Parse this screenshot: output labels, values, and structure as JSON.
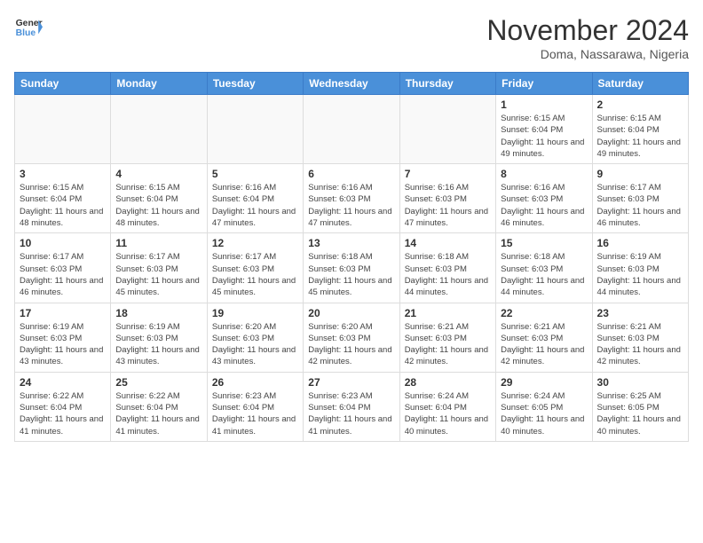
{
  "logo": {
    "line1": "General",
    "line2": "Blue"
  },
  "calendar": {
    "title": "November 2024",
    "subtitle": "Doma, Nassarawa, Nigeria",
    "headers": [
      "Sunday",
      "Monday",
      "Tuesday",
      "Wednesday",
      "Thursday",
      "Friday",
      "Saturday"
    ],
    "weeks": [
      [
        {
          "day": "",
          "info": ""
        },
        {
          "day": "",
          "info": ""
        },
        {
          "day": "",
          "info": ""
        },
        {
          "day": "",
          "info": ""
        },
        {
          "day": "",
          "info": ""
        },
        {
          "day": "1",
          "info": "Sunrise: 6:15 AM\nSunset: 6:04 PM\nDaylight: 11 hours and 49 minutes."
        },
        {
          "day": "2",
          "info": "Sunrise: 6:15 AM\nSunset: 6:04 PM\nDaylight: 11 hours and 49 minutes."
        }
      ],
      [
        {
          "day": "3",
          "info": "Sunrise: 6:15 AM\nSunset: 6:04 PM\nDaylight: 11 hours and 48 minutes."
        },
        {
          "day": "4",
          "info": "Sunrise: 6:15 AM\nSunset: 6:04 PM\nDaylight: 11 hours and 48 minutes."
        },
        {
          "day": "5",
          "info": "Sunrise: 6:16 AM\nSunset: 6:04 PM\nDaylight: 11 hours and 47 minutes."
        },
        {
          "day": "6",
          "info": "Sunrise: 6:16 AM\nSunset: 6:03 PM\nDaylight: 11 hours and 47 minutes."
        },
        {
          "day": "7",
          "info": "Sunrise: 6:16 AM\nSunset: 6:03 PM\nDaylight: 11 hours and 47 minutes."
        },
        {
          "day": "8",
          "info": "Sunrise: 6:16 AM\nSunset: 6:03 PM\nDaylight: 11 hours and 46 minutes."
        },
        {
          "day": "9",
          "info": "Sunrise: 6:17 AM\nSunset: 6:03 PM\nDaylight: 11 hours and 46 minutes."
        }
      ],
      [
        {
          "day": "10",
          "info": "Sunrise: 6:17 AM\nSunset: 6:03 PM\nDaylight: 11 hours and 46 minutes."
        },
        {
          "day": "11",
          "info": "Sunrise: 6:17 AM\nSunset: 6:03 PM\nDaylight: 11 hours and 45 minutes."
        },
        {
          "day": "12",
          "info": "Sunrise: 6:17 AM\nSunset: 6:03 PM\nDaylight: 11 hours and 45 minutes."
        },
        {
          "day": "13",
          "info": "Sunrise: 6:18 AM\nSunset: 6:03 PM\nDaylight: 11 hours and 45 minutes."
        },
        {
          "day": "14",
          "info": "Sunrise: 6:18 AM\nSunset: 6:03 PM\nDaylight: 11 hours and 44 minutes."
        },
        {
          "day": "15",
          "info": "Sunrise: 6:18 AM\nSunset: 6:03 PM\nDaylight: 11 hours and 44 minutes."
        },
        {
          "day": "16",
          "info": "Sunrise: 6:19 AM\nSunset: 6:03 PM\nDaylight: 11 hours and 44 minutes."
        }
      ],
      [
        {
          "day": "17",
          "info": "Sunrise: 6:19 AM\nSunset: 6:03 PM\nDaylight: 11 hours and 43 minutes."
        },
        {
          "day": "18",
          "info": "Sunrise: 6:19 AM\nSunset: 6:03 PM\nDaylight: 11 hours and 43 minutes."
        },
        {
          "day": "19",
          "info": "Sunrise: 6:20 AM\nSunset: 6:03 PM\nDaylight: 11 hours and 43 minutes."
        },
        {
          "day": "20",
          "info": "Sunrise: 6:20 AM\nSunset: 6:03 PM\nDaylight: 11 hours and 42 minutes."
        },
        {
          "day": "21",
          "info": "Sunrise: 6:21 AM\nSunset: 6:03 PM\nDaylight: 11 hours and 42 minutes."
        },
        {
          "day": "22",
          "info": "Sunrise: 6:21 AM\nSunset: 6:03 PM\nDaylight: 11 hours and 42 minutes."
        },
        {
          "day": "23",
          "info": "Sunrise: 6:21 AM\nSunset: 6:03 PM\nDaylight: 11 hours and 42 minutes."
        }
      ],
      [
        {
          "day": "24",
          "info": "Sunrise: 6:22 AM\nSunset: 6:04 PM\nDaylight: 11 hours and 41 minutes."
        },
        {
          "day": "25",
          "info": "Sunrise: 6:22 AM\nSunset: 6:04 PM\nDaylight: 11 hours and 41 minutes."
        },
        {
          "day": "26",
          "info": "Sunrise: 6:23 AM\nSunset: 6:04 PM\nDaylight: 11 hours and 41 minutes."
        },
        {
          "day": "27",
          "info": "Sunrise: 6:23 AM\nSunset: 6:04 PM\nDaylight: 11 hours and 41 minutes."
        },
        {
          "day": "28",
          "info": "Sunrise: 6:24 AM\nSunset: 6:04 PM\nDaylight: 11 hours and 40 minutes."
        },
        {
          "day": "29",
          "info": "Sunrise: 6:24 AM\nSunset: 6:05 PM\nDaylight: 11 hours and 40 minutes."
        },
        {
          "day": "30",
          "info": "Sunrise: 6:25 AM\nSunset: 6:05 PM\nDaylight: 11 hours and 40 minutes."
        }
      ]
    ]
  }
}
